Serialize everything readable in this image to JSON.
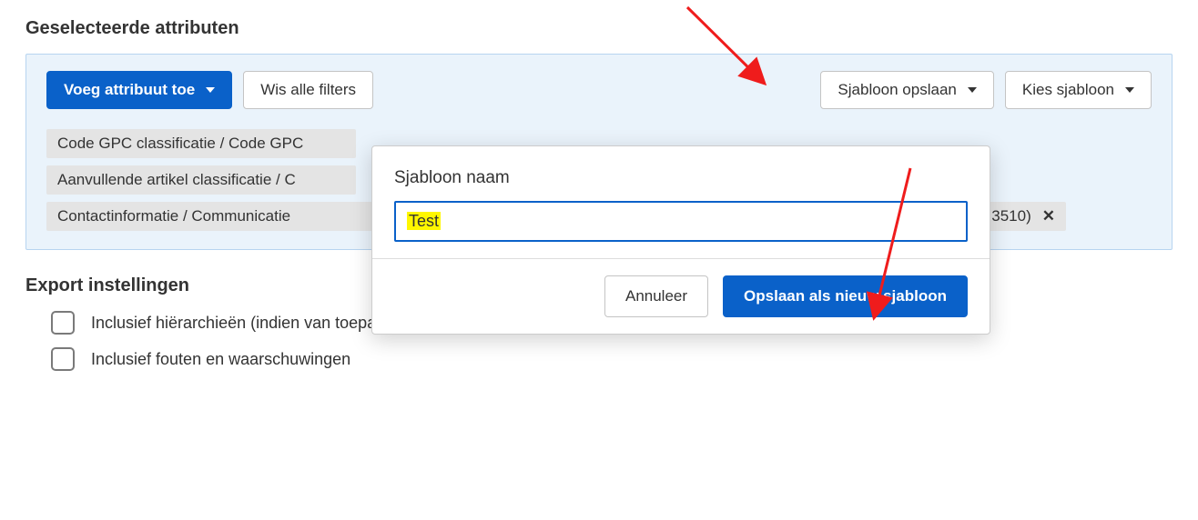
{
  "section": {
    "title": "Geselecteerde attributen"
  },
  "toolbar": {
    "add_attribute": "Voeg attribuut toe",
    "clear_filters": "Wis alle filters",
    "save_template": "Sjabloon opslaan",
    "choose_template": "Kies sjabloon"
  },
  "attributes": [
    "Code GPC classificatie / Code GPC",
    "Aanvullende artikel classificatie / C",
    "Contactinformatie / Communicatie"
  ],
  "attribute_tail": {
    "code_fragment": "3510)"
  },
  "popover": {
    "label": "Sjabloon naam",
    "value": "Test",
    "cancel": "Annuleer",
    "save_new": "Opslaan als nieuw sjabloon"
  },
  "export_settings": {
    "title": "Export instellingen",
    "opt_hierarchies": "Inclusief hiërarchieën (indien van toepassing)",
    "opt_errors": "Inclusief fouten en waarschuwingen"
  },
  "arrow_color": "#ef1c1c"
}
